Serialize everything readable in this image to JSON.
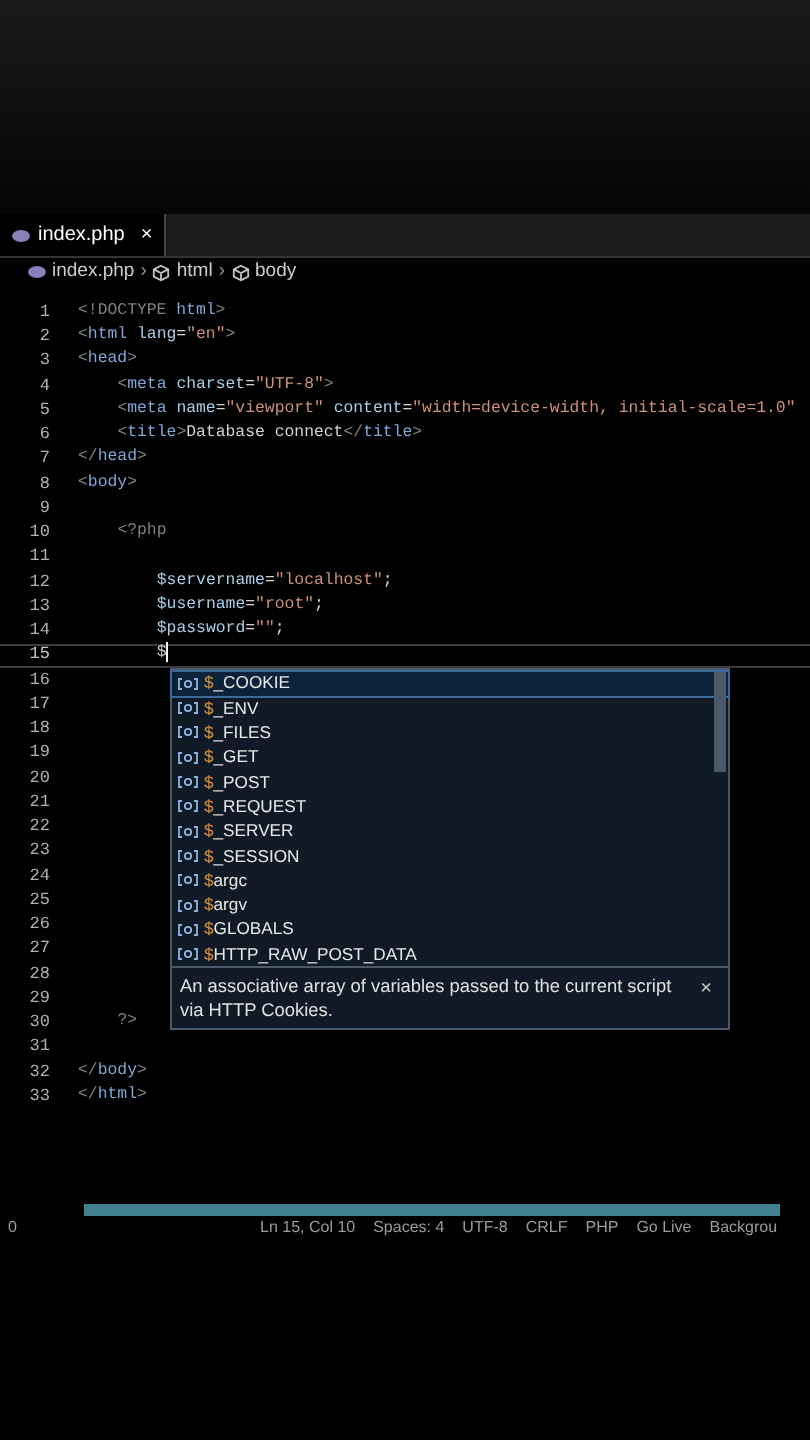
{
  "tabs": [
    {
      "label": "index.php",
      "selected": true,
      "close": "×"
    }
  ],
  "breadcrumb": [
    {
      "kind": "file",
      "label": "index.php"
    },
    {
      "kind": "symbol",
      "separator": "›",
      "label": "html"
    },
    {
      "kind": "symbol",
      "separator": "›",
      "label": "body"
    }
  ],
  "code": {
    "lines": [
      {
        "number": "1",
        "current": false,
        "tokens": [
          {
            "kind": "punct",
            "text": "<!DOCTYPE "
          },
          {
            "kind": "tag",
            "text": "html"
          },
          {
            "kind": "punct",
            "text": ">"
          }
        ]
      },
      {
        "number": "2",
        "current": false,
        "tokens": [
          {
            "kind": "punct",
            "text": "<"
          },
          {
            "kind": "tag",
            "text": "html "
          },
          {
            "kind": "attr",
            "text": "lang"
          },
          {
            "kind": "text",
            "text": "="
          },
          {
            "kind": "string",
            "text": "\"en\""
          },
          {
            "kind": "punct",
            "text": ">"
          }
        ]
      },
      {
        "number": "3",
        "current": false,
        "tokens": [
          {
            "kind": "punct",
            "text": "<"
          },
          {
            "kind": "tag",
            "text": "head"
          },
          {
            "kind": "punct",
            "text": ">"
          }
        ],
        "children": [
          {
            "number": "4",
            "current": false,
            "tokens": [
              {
                "kind": "punct",
                "text": "<"
              },
              {
                "kind": "tag",
                "text": "meta "
              },
              {
                "kind": "attr",
                "text": "charset"
              },
              {
                "kind": "text",
                "text": "="
              },
              {
                "kind": "string",
                "text": "\"UTF-8\""
              },
              {
                "kind": "punct",
                "text": ">"
              }
            ]
          },
          {
            "number": "5",
            "current": false,
            "tokens": [
              {
                "kind": "punct",
                "text": "<"
              },
              {
                "kind": "tag",
                "text": "meta "
              },
              {
                "kind": "attr",
                "text": "name"
              },
              {
                "kind": "text",
                "text": "="
              },
              {
                "kind": "string",
                "text": "\"viewport\" "
              },
              {
                "kind": "attr",
                "text": "content"
              },
              {
                "kind": "text",
                "text": "="
              },
              {
                "kind": "string",
                "text": "\"width=device-width, initial-scale=1.0\""
              }
            ]
          },
          {
            "number": "6",
            "current": false,
            "tokens": [
              {
                "kind": "punct",
                "text": "<"
              },
              {
                "kind": "tag",
                "text": "title"
              },
              {
                "kind": "punct",
                "text": ">"
              },
              {
                "kind": "text",
                "text": "Database connect"
              },
              {
                "kind": "punct",
                "text": "</"
              },
              {
                "kind": "tag",
                "text": "title"
              },
              {
                "kind": "punct",
                "text": ">"
              }
            ]
          }
        ]
      },
      {
        "number": "7",
        "current": false,
        "tokens": [
          {
            "kind": "punct",
            "text": "</"
          },
          {
            "kind": "tag",
            "text": "head"
          },
          {
            "kind": "punct",
            "text": ">"
          }
        ]
      },
      {
        "number": "8",
        "current": false,
        "tokens": [
          {
            "kind": "punct",
            "text": "<"
          },
          {
            "kind": "tag",
            "text": "body"
          },
          {
            "kind": "punct",
            "text": ">"
          }
        ],
        "children": [
          {
            "number": "9",
            "current": false
          },
          {
            "number": "10",
            "current": false,
            "tokens": [
              {
                "kind": "punct",
                "text": "<?php"
              }
            ],
            "children": [
              {
                "number": "11",
                "current": false
              },
              {
                "number": "12",
                "current": false,
                "tokens": [
                  {
                    "kind": "variable",
                    "text": "$servername"
                  },
                  {
                    "kind": "text",
                    "text": "="
                  },
                  {
                    "kind": "string",
                    "text": "\"localhost\""
                  },
                  {
                    "kind": "text",
                    "text": ";"
                  }
                ]
              },
              {
                "number": "13",
                "current": false,
                "tokens": [
                  {
                    "kind": "variable",
                    "text": "$username"
                  },
                  {
                    "kind": "text",
                    "text": "="
                  },
                  {
                    "kind": "string",
                    "text": "\"root\""
                  },
                  {
                    "kind": "text",
                    "text": ";"
                  }
                ]
              },
              {
                "number": "14",
                "current": false,
                "tokens": [
                  {
                    "kind": "variable",
                    "text": "$password"
                  },
                  {
                    "kind": "text",
                    "text": "="
                  },
                  {
                    "kind": "string",
                    "text": "\"\""
                  },
                  {
                    "kind": "text",
                    "text": ";"
                  }
                ]
              },
              {
                "number": "15",
                "current": true,
                "tokens": [
                  {
                    "kind": "text",
                    "text": "$"
                  }
                ]
              },
              {
                "number": "16",
                "current": false
              },
              {
                "number": "17",
                "current": false
              },
              {
                "number": "18",
                "current": false
              },
              {
                "number": "19",
                "current": false
              },
              {
                "number": "20",
                "current": false
              },
              {
                "number": "21",
                "current": false
              },
              {
                "number": "22",
                "current": false
              },
              {
                "number": "23",
                "current": false
              },
              {
                "number": "24",
                "current": false
              },
              {
                "number": "25",
                "current": false
              },
              {
                "number": "26",
                "current": false
              },
              {
                "number": "27",
                "current": false
              },
              {
                "number": "28",
                "current": false
              },
              {
                "number": "29",
                "current": false
              }
            ]
          },
          {
            "number": "30",
            "current": false,
            "tokens": [
              {
                "kind": "punct",
                "text": "?>"
              }
            ]
          },
          {
            "number": "31",
            "current": false
          }
        ]
      },
      {
        "number": "32",
        "current": false,
        "tokens": [
          {
            "kind": "punct",
            "text": "</"
          },
          {
            "kind": "tag",
            "text": "body"
          },
          {
            "kind": "punct",
            "text": ">"
          }
        ]
      },
      {
        "number": "33",
        "current": false,
        "tokens": [
          {
            "kind": "punct",
            "text": "</"
          },
          {
            "kind": "tag",
            "text": "html"
          },
          {
            "kind": "punct",
            "text": ">"
          }
        ]
      }
    ]
  },
  "suggestions": {
    "items": [
      {
        "prefix": "$",
        "name": "_COOKIE",
        "selected": true
      },
      {
        "prefix": "$",
        "name": "_ENV",
        "selected": false
      },
      {
        "prefix": "$",
        "name": "_FILES",
        "selected": false
      },
      {
        "prefix": "$",
        "name": "_GET",
        "selected": false
      },
      {
        "prefix": "$",
        "name": "_POST",
        "selected": false
      },
      {
        "prefix": "$",
        "name": "_REQUEST",
        "selected": false
      },
      {
        "prefix": "$",
        "name": "_SERVER",
        "selected": false
      },
      {
        "prefix": "$",
        "name": "_SESSION",
        "selected": false
      },
      {
        "prefix": "$",
        "name": "argc",
        "selected": false
      },
      {
        "prefix": "$",
        "name": "argv",
        "selected": false
      },
      {
        "prefix": "$",
        "name": "GLOBALS",
        "selected": false
      },
      {
        "prefix": "$",
        "name": "HTTP_RAW_POST_DATA",
        "selected": false
      }
    ],
    "documentation": "An associative array of variables passed to the current script via HTTP Cookies.",
    "close": "×"
  },
  "status_bar": [
    "0",
    "Ln 15, Col 10",
    "Spaces: 4",
    "UTF-8",
    "CRLF",
    "PHP",
    "Go Live",
    "Backgrou"
  ]
}
